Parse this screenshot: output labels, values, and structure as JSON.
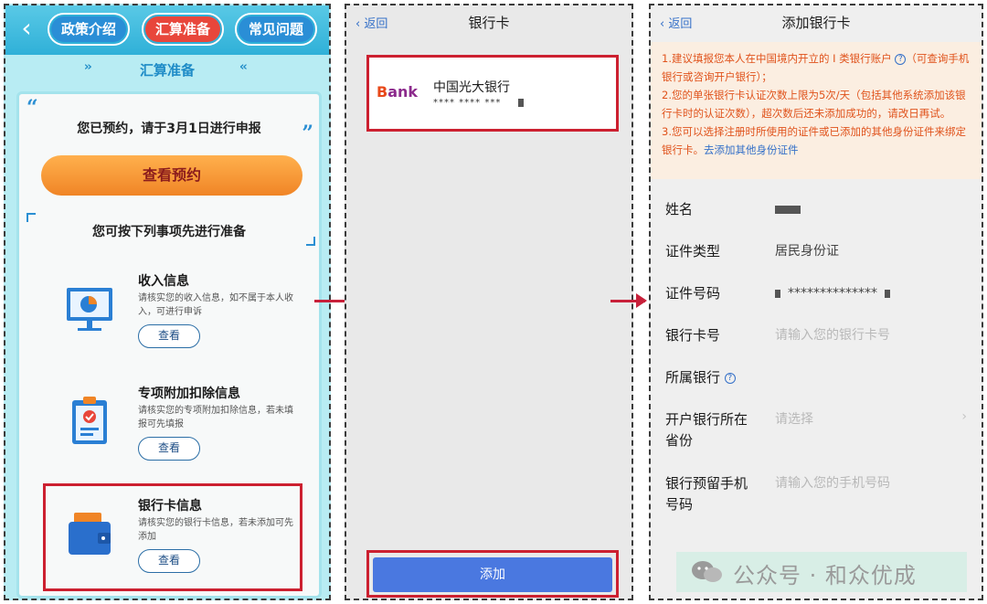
{
  "panel1": {
    "tabs": [
      "政策介绍",
      "汇算准备",
      "常见问题"
    ],
    "section_title": "汇算准备",
    "appointment_text": "您已预约，请于3月1日进行申报",
    "view_appointment": "查看预约",
    "prepare_text": "您可按下列事项先进行准备",
    "items": [
      {
        "title": "收入信息",
        "desc": "请核实您的收入信息，如不属于本人收入，可进行申诉",
        "button": "查看"
      },
      {
        "title": "专项附加扣除信息",
        "desc": "请核实您的专项附加扣除信息，若未填报可先填报",
        "button": "查看"
      },
      {
        "title": "银行卡信息",
        "desc": "请核实您的银行卡信息，若未添加可先添加",
        "button": "查看"
      }
    ]
  },
  "panel2": {
    "back": "返回",
    "title": "银行卡",
    "bank_logo": "Bank",
    "bank_name": "中国光大银行",
    "card_number": "**** **** ***",
    "add_button": "添加"
  },
  "panel3": {
    "back": "返回",
    "title": "添加银行卡",
    "notice": {
      "line1": "1.建议填报您本人在中国境内开立的 I 类银行账户",
      "line1b": "（可查询手机银行或咨询开户银行）；",
      "line2": "2.您的单张银行卡认证次数上限为5次/天（包括其他系统添加该银行卡时的认证次数），超次数后还未添加成功的，请改日再试。",
      "line3": "3.您可以选择注册时所使用的证件或已添加的其他身份证件来绑定银行卡。",
      "link": "去添加其他身份证件"
    },
    "fields": {
      "name_label": "姓名",
      "id_type_label": "证件类型",
      "id_type_value": "居民身份证",
      "id_number_label": "证件号码",
      "id_number_value": "**************",
      "card_number_label": "银行卡号",
      "card_number_placeholder": "请输入您的银行卡号",
      "bank_label": "所属银行",
      "province_label_1": "开户银行所在",
      "province_label_2": "省份",
      "province_placeholder": "请选择",
      "phone_label_1": "银行预留手机",
      "phone_label_2": "号码",
      "phone_placeholder": "请输入您的手机号码"
    },
    "watermark": "公众号 · 和众优成"
  },
  "colors": {
    "accent_red": "#cc2030",
    "blue": "#3470c8",
    "orange": "#f08526"
  }
}
